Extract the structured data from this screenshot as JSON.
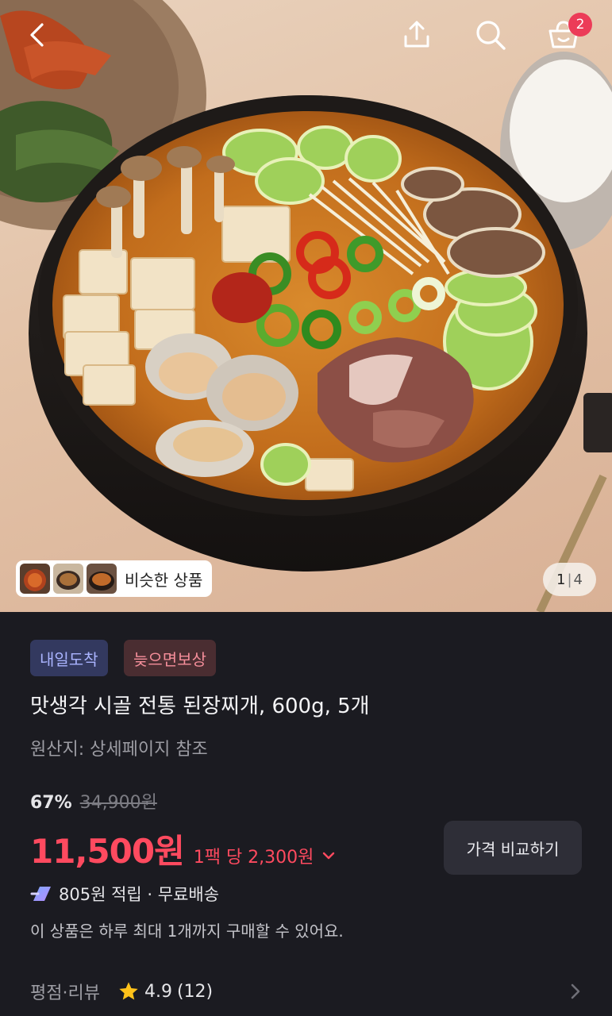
{
  "header": {
    "cart_count": "2",
    "icons": [
      "back-icon",
      "share-icon",
      "search-icon",
      "cart-icon"
    ]
  },
  "gallery": {
    "similar_label": "비슷한 상품",
    "page_current": "1",
    "page_total": "4"
  },
  "product": {
    "badges": [
      "내일도착",
      "늦으면보상"
    ],
    "title": "맛생각 시골 전통 된장찌개, 600g, 5개",
    "origin": "원산지: 상세페이지 참조",
    "discount": "67%",
    "original_price": "34,900원",
    "price": "11,500원",
    "unit_price": "1팩 당 2,300원",
    "compare_button": "가격 비교하기",
    "benefit": "805원 적립 · 무료배송",
    "limit_note": "이 상품은 하루 최대 1개까지 구매할 수 있어요."
  },
  "review": {
    "label": "평점·리뷰",
    "rating": "4.9",
    "count": "(12)"
  },
  "colors": {
    "price_accent": "#ff4a5f",
    "badge_badge": "#ec3c58",
    "panel_bg": "#1b1b21"
  }
}
